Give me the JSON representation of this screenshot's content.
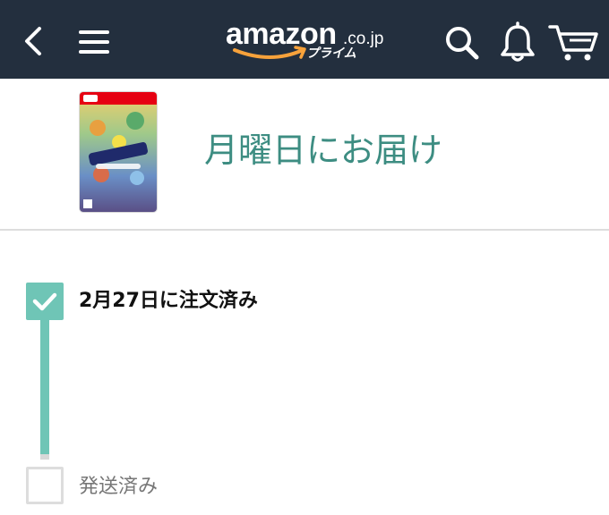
{
  "header": {
    "logo_word": "amazon",
    "logo_domain": ".co.jp",
    "logo_prime": "プライム",
    "icons": [
      "back-icon",
      "menu-icon",
      "search-icon",
      "bell-icon",
      "cart-icon"
    ]
  },
  "delivery": {
    "title": "月曜日にお届け"
  },
  "tracking": {
    "steps": [
      {
        "label": "2月27日に注文済み",
        "status": "done"
      },
      {
        "label": "発送済み",
        "status": "pending"
      }
    ]
  },
  "colors": {
    "header_bg": "#232f3e",
    "accent_teal": "#3d8d82",
    "progress_teal": "#6fc5b6",
    "smile_orange": "#f7a23b"
  }
}
